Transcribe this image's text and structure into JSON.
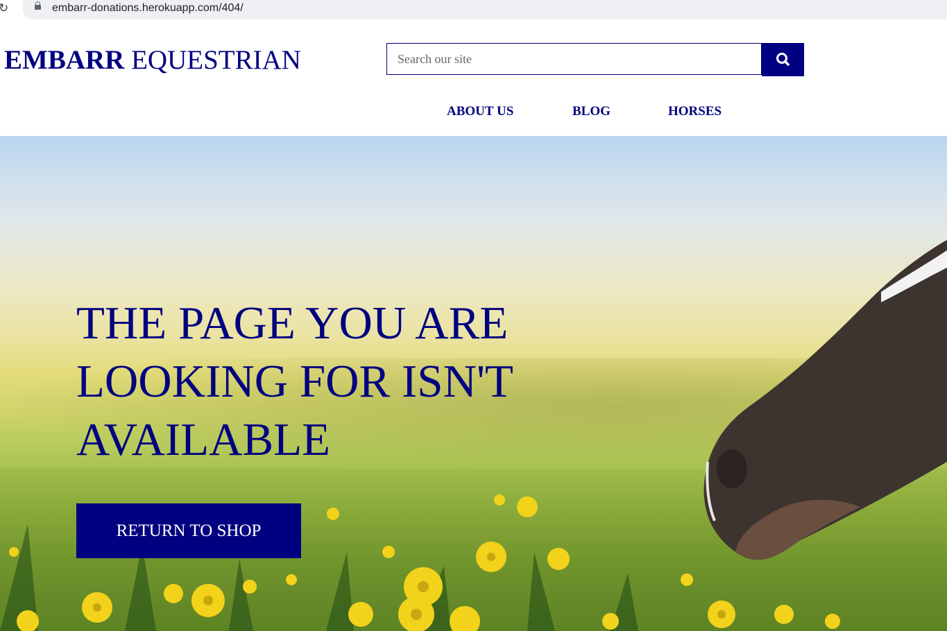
{
  "browser": {
    "url": "embarr-donations.herokuapp.com/404/",
    "reload_icon": "reload-icon",
    "lock_icon": "lock-icon"
  },
  "header": {
    "logo_bold": "EMBARR",
    "logo_regular": "EQUESTRIAN",
    "search_placeholder": "Search our site",
    "search_icon": "search-icon"
  },
  "nav": {
    "items": [
      {
        "label": "ABOUT US"
      },
      {
        "label": "BLOG"
      },
      {
        "label": "HORSES"
      }
    ]
  },
  "hero": {
    "title": "THE PAGE YOU ARE LOOKING FOR ISN'T AVAILABLE",
    "cta_label": "RETURN TO SHOP",
    "image": "horse-in-dandelion-meadow"
  },
  "colors": {
    "brand": "#000080",
    "text_on_brand": "#ffffff"
  }
}
